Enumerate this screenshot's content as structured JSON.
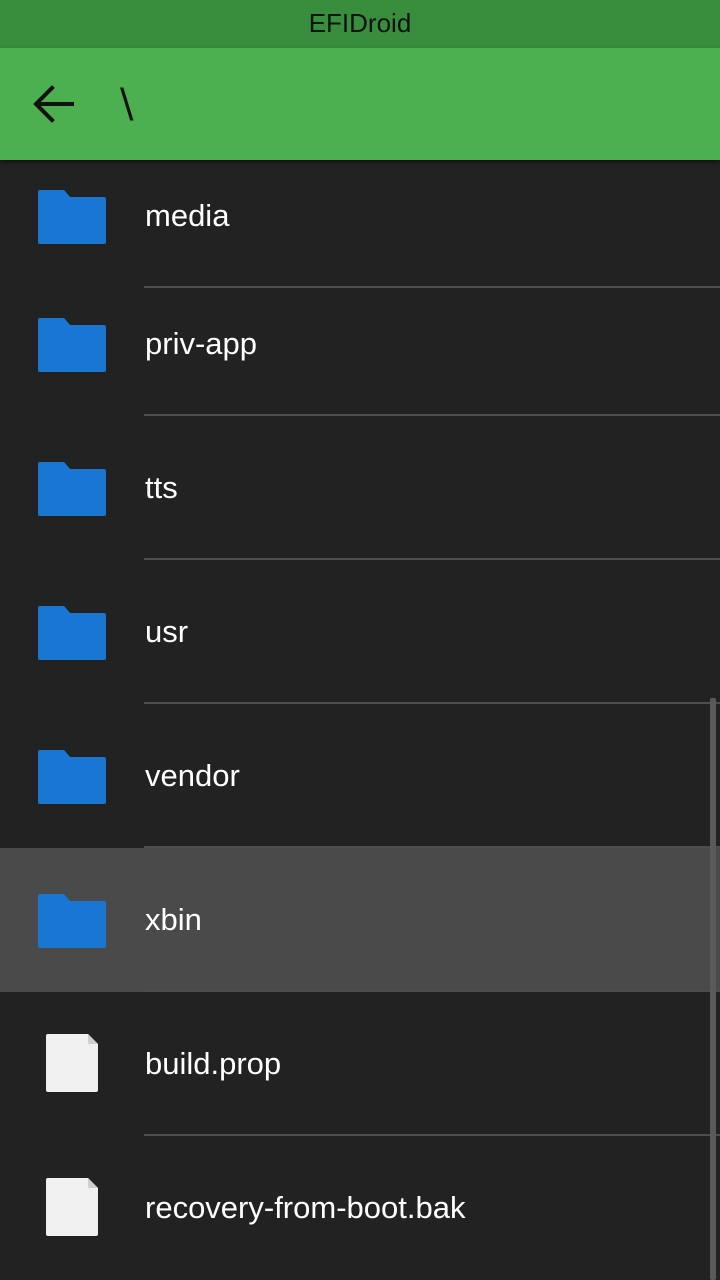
{
  "statusbar": {
    "title": "EFIDroid"
  },
  "appbar": {
    "back_icon": "arrow-left-icon",
    "path": "\\"
  },
  "colors": {
    "statusbar": "#388E3C",
    "appbar": "#4CAF50",
    "background": "#222222",
    "selected_row": "#4A4A4A",
    "folder": "#1976D2",
    "file": "#F0F0F0"
  },
  "entries": [
    {
      "name": "media",
      "type": "folder",
      "icon": "folder-icon"
    },
    {
      "name": "priv-app",
      "type": "folder",
      "icon": "folder-icon"
    },
    {
      "name": "tts",
      "type": "folder",
      "icon": "folder-icon"
    },
    {
      "name": "usr",
      "type": "folder",
      "icon": "folder-icon"
    },
    {
      "name": "vendor",
      "type": "folder",
      "icon": "folder-icon"
    },
    {
      "name": "xbin",
      "type": "folder",
      "icon": "folder-icon",
      "selected": true
    },
    {
      "name": "build.prop",
      "type": "file",
      "icon": "file-icon"
    },
    {
      "name": "recovery-from-boot.bak",
      "type": "file",
      "icon": "file-icon"
    }
  ]
}
